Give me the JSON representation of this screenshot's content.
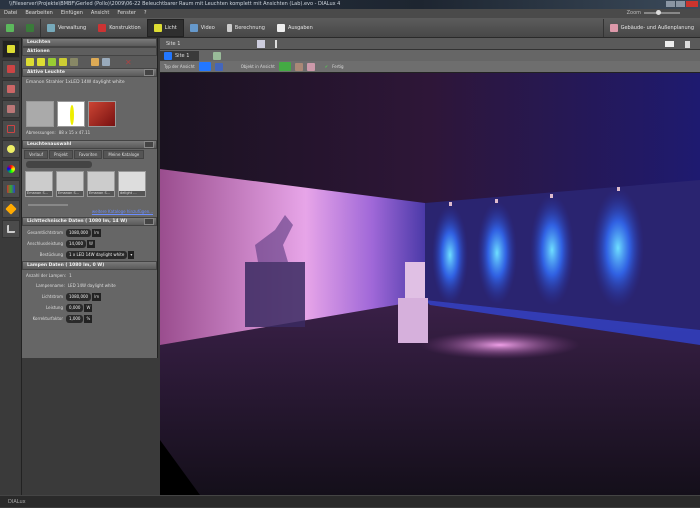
{
  "window": {
    "title": "\\\\Fileserver\\Projekte\\BMBF\\Gerled (Pollo)\\2009\\06-22 Beleuchtbarer Raum mit Leuchten komplett mit Ansichten (Lab).evo - DIALux 4"
  },
  "menu": [
    "Datei",
    "Bearbeiten",
    "Einfügen",
    "Ansicht",
    "Fenster",
    "?"
  ],
  "zoom_label": "Zoom",
  "toolbar": {
    "tabs": [
      {
        "label": "Verwaltung"
      },
      {
        "label": "Konstruktion"
      },
      {
        "label": "Licht",
        "active": true
      },
      {
        "label": "Video"
      },
      {
        "label": "Berechnung"
      },
      {
        "label": "Ausgaben"
      }
    ],
    "right": "Gebäude- und Außenplanung"
  },
  "panel": {
    "header": "Leuchten",
    "sub": "Aktionen",
    "active_luminaire": {
      "title": "Aktive Leuchte",
      "name": "Emanon Strahler 1xLED 14W daylight white",
      "dimensions": "Abmessungen:",
      "dimensions_value": "88 x 15 x 47.11"
    },
    "selection": {
      "title": "Leuchtenauswahl",
      "tabs": [
        "Verlauf",
        "Projekt",
        "Favoriten",
        "Meine Kataloge"
      ],
      "search_placeholder": "",
      "items": [
        "Emanon S...",
        "Emanon S...",
        "Emanon S...",
        "delight ..."
      ],
      "link": "weitere Kataloge hinzufügen..."
    },
    "photometric": {
      "title": "Lichttechnische Daten ( 1080 lm, 14 W)",
      "fields": [
        {
          "label": "Gesamtlichtstrom",
          "value": "1080,000",
          "unit": "lm"
        },
        {
          "label": "Anschlussleistung",
          "value": "14,000",
          "unit": "W"
        },
        {
          "label": "Bestückung",
          "value": "1 x LED 14W daylight white",
          "unit": "▾"
        }
      ]
    },
    "lamp": {
      "title": "Lampen Daten ( 1080 lm, 0 W)",
      "count_label": "Anzahl der Lampen:",
      "count": "1",
      "type_label": "Lampenname:",
      "type": "LED 14W daylight white",
      "fields": [
        {
          "label": "Lichtstrom",
          "value": "1080,000",
          "unit": "lm"
        },
        {
          "label": "Leistung",
          "value": "0,000",
          "unit": "W"
        },
        {
          "label": "Korrekturfaktor",
          "value": "1,000",
          "unit": "%"
        }
      ]
    }
  },
  "view": {
    "header": "Site 1",
    "tab": "Site 1",
    "toolbar": {
      "view_type": "Typ der Ansicht",
      "object_in_view": "Objekt in Ansicht",
      "done": "Fertig"
    }
  },
  "status": "DIALux"
}
